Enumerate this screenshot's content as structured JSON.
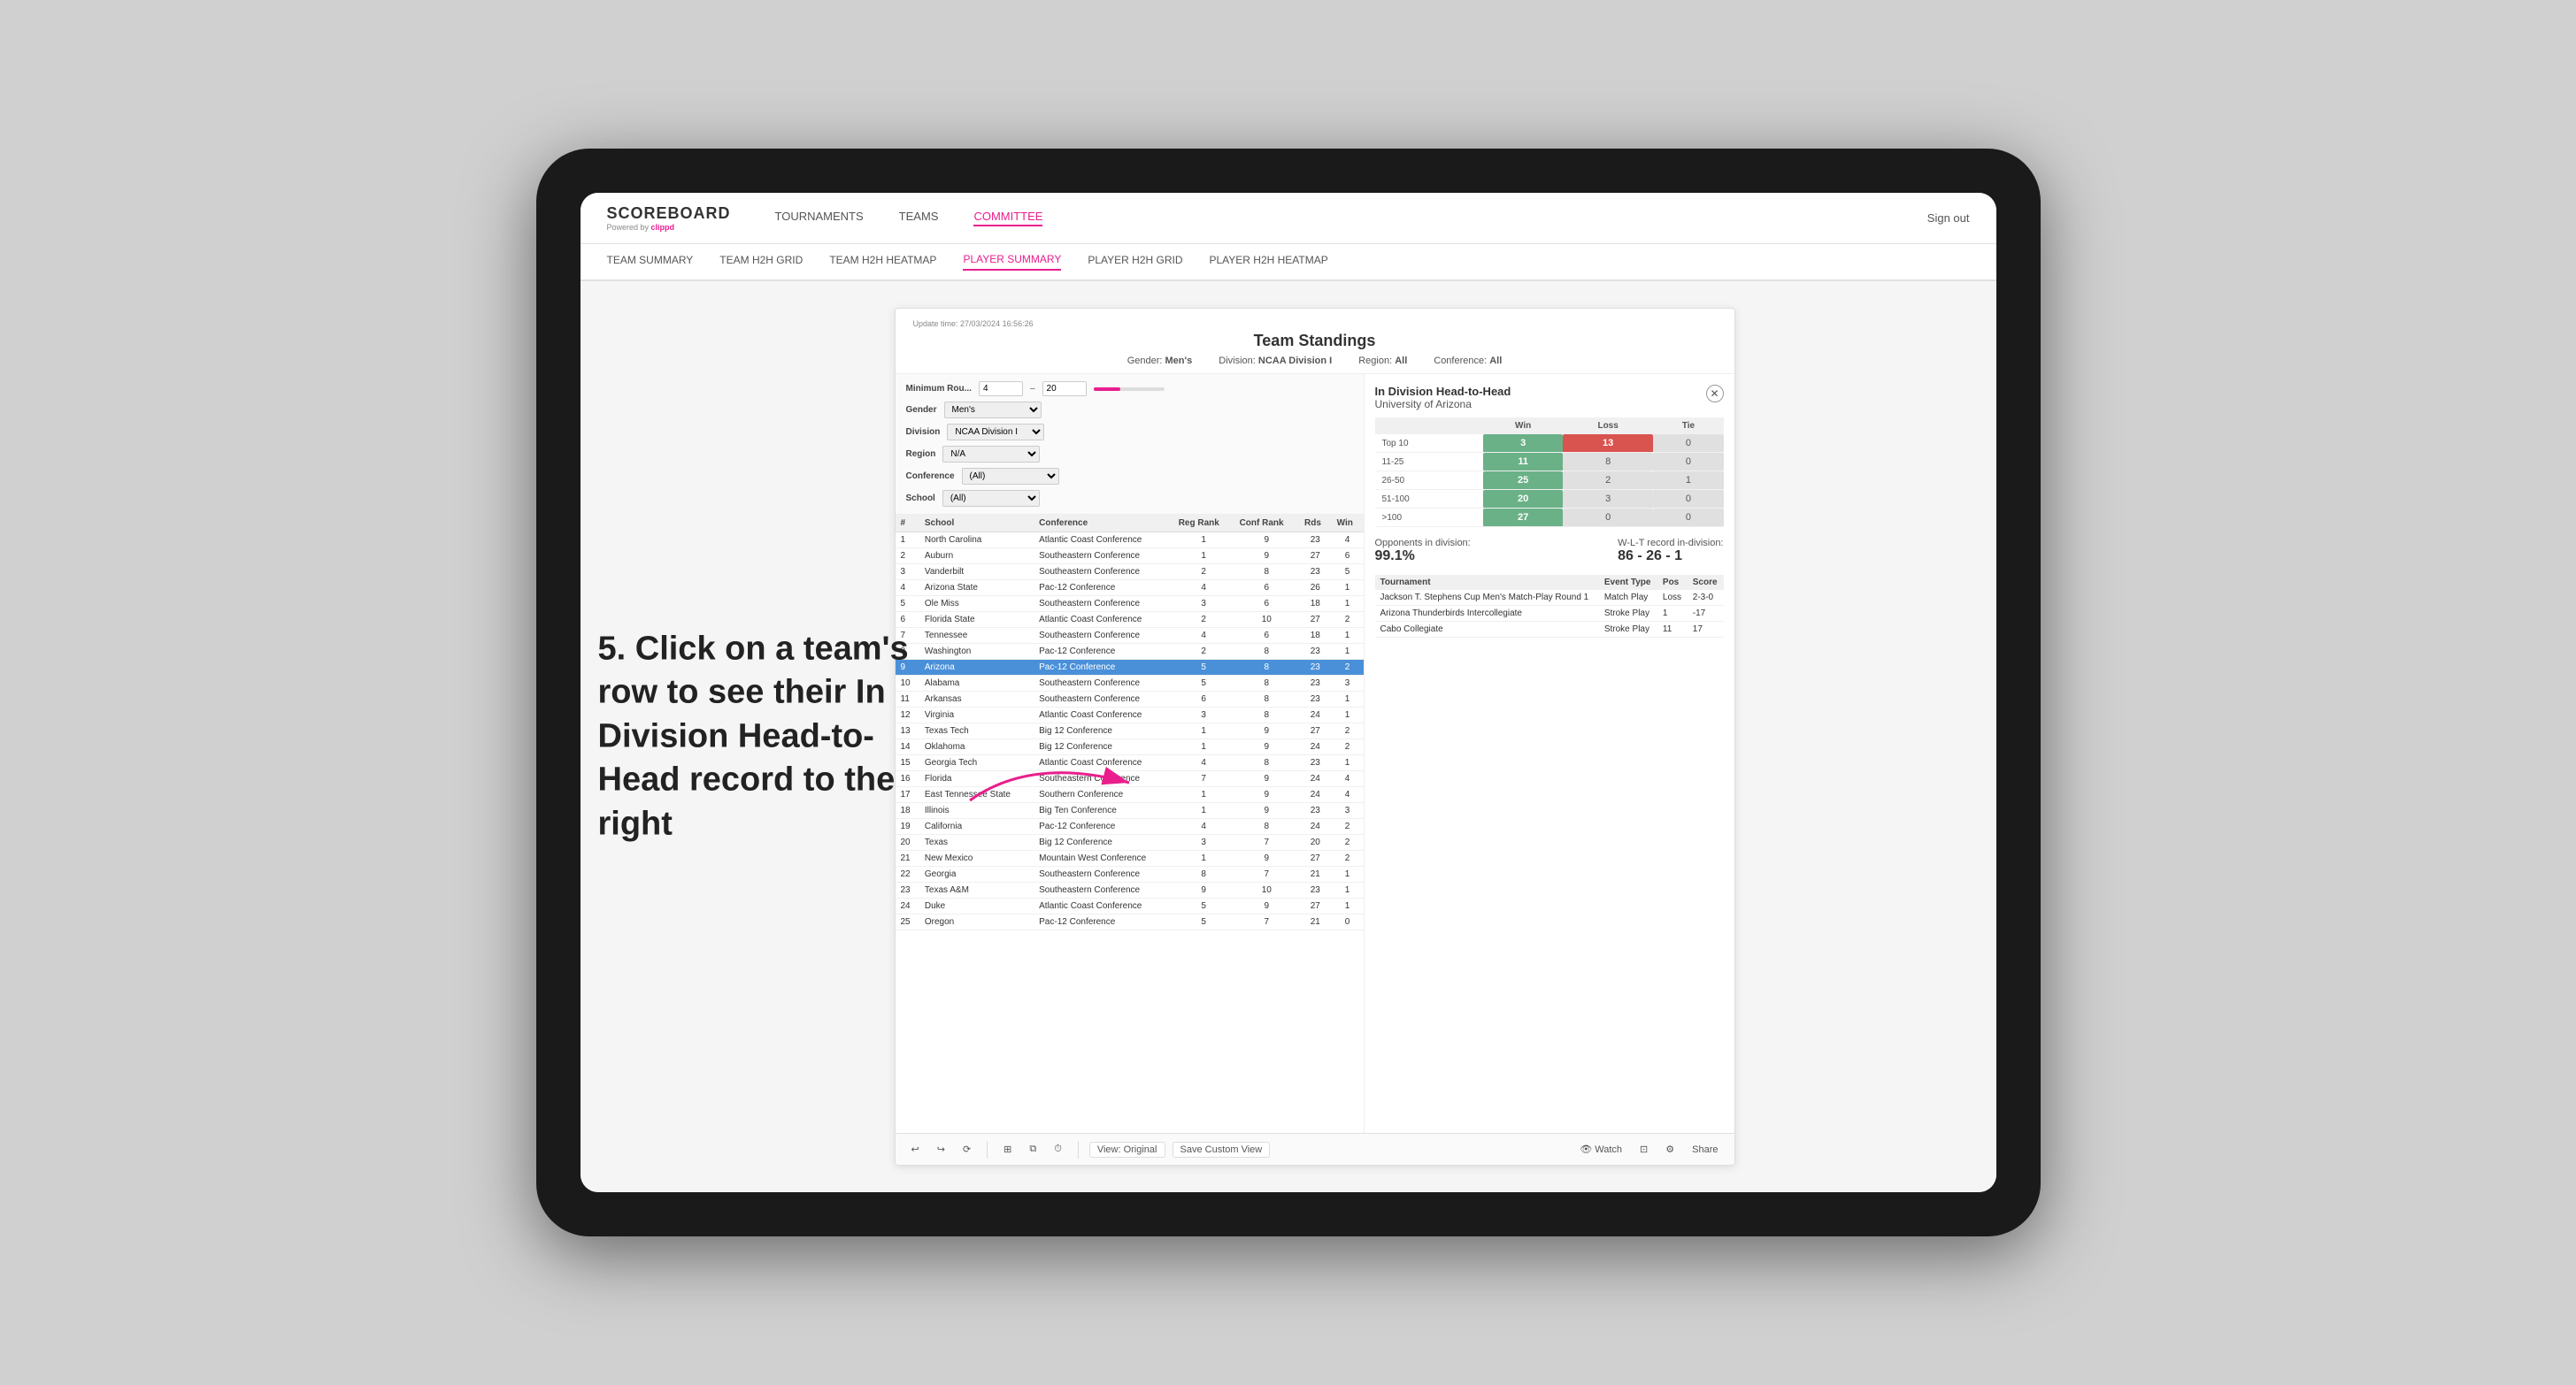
{
  "background": "#d0d0d0",
  "annotation": {
    "text": "5. Click on a team's row to see their In Division Head-to-Head record to the right"
  },
  "nav": {
    "logo": "SCOREBOARD",
    "logo_sub": "Powered by",
    "logo_brand": "clippd",
    "items": [
      "TOURNAMENTS",
      "TEAMS",
      "COMMITTEE"
    ],
    "active_item": "COMMITTEE",
    "sign_out": "Sign out"
  },
  "sub_nav": {
    "items": [
      "TEAM SUMMARY",
      "TEAM H2H GRID",
      "TEAM H2H HEATMAP",
      "PLAYER SUMMARY",
      "PLAYER H2H GRID",
      "PLAYER H2H HEATMAP"
    ],
    "active_item": "PLAYER SUMMARY"
  },
  "panel": {
    "update_time": "Update time: 27/03/2024 16:56:26",
    "title": "Team Standings",
    "filters": {
      "gender": "Men's",
      "division": "NCAA Division I",
      "region": "All",
      "conference": "All"
    },
    "filters_labels": {
      "gender": "Gender:",
      "division": "Division:",
      "region": "Region:",
      "conference": "Conference:"
    },
    "left_filters": {
      "min_rounds_label": "Minimum Rou...",
      "min_rounds_value": "4",
      "max_rounds_value": "20",
      "gender_label": "Gender",
      "gender_value": "Men's",
      "division_label": "Division",
      "division_value": "NCAA Division I",
      "region_label": "Region",
      "region_value": "N/A",
      "conference_label": "Conference",
      "conference_value": "(All)",
      "school_label": "School",
      "school_value": "(All)"
    },
    "table": {
      "columns": [
        "#",
        "School",
        "Conference",
        "Reg Rank",
        "Conf Rank",
        "Rds",
        "Win"
      ],
      "rows": [
        {
          "num": "1",
          "school": "North Carolina",
          "conference": "Atlantic Coast Conference",
          "reg_rank": "1",
          "conf_rank": "9",
          "rds": "23",
          "win": "4"
        },
        {
          "num": "2",
          "school": "Auburn",
          "conference": "Southeastern Conference",
          "reg_rank": "1",
          "conf_rank": "9",
          "rds": "27",
          "win": "6"
        },
        {
          "num": "3",
          "school": "Vanderbilt",
          "conference": "Southeastern Conference",
          "reg_rank": "2",
          "conf_rank": "8",
          "rds": "23",
          "win": "5"
        },
        {
          "num": "4",
          "school": "Arizona State",
          "conference": "Pac-12 Conference",
          "reg_rank": "4",
          "conf_rank": "6",
          "rds": "26",
          "win": "1"
        },
        {
          "num": "5",
          "school": "Ole Miss",
          "conference": "Southeastern Conference",
          "reg_rank": "3",
          "conf_rank": "6",
          "rds": "18",
          "win": "1"
        },
        {
          "num": "6",
          "school": "Florida State",
          "conference": "Atlantic Coast Conference",
          "reg_rank": "2",
          "conf_rank": "10",
          "rds": "27",
          "win": "2"
        },
        {
          "num": "7",
          "school": "Tennessee",
          "conference": "Southeastern Conference",
          "reg_rank": "4",
          "conf_rank": "6",
          "rds": "18",
          "win": "1"
        },
        {
          "num": "8",
          "school": "Washington",
          "conference": "Pac-12 Conference",
          "reg_rank": "2",
          "conf_rank": "8",
          "rds": "23",
          "win": "1"
        },
        {
          "num": "9",
          "school": "Arizona",
          "conference": "Pac-12 Conference",
          "reg_rank": "5",
          "conf_rank": "8",
          "rds": "23",
          "win": "2",
          "highlighted": true
        },
        {
          "num": "10",
          "school": "Alabama",
          "conference": "Southeastern Conference",
          "reg_rank": "5",
          "conf_rank": "8",
          "rds": "23",
          "win": "3"
        },
        {
          "num": "11",
          "school": "Arkansas",
          "conference": "Southeastern Conference",
          "reg_rank": "6",
          "conf_rank": "8",
          "rds": "23",
          "win": "1"
        },
        {
          "num": "12",
          "school": "Virginia",
          "conference": "Atlantic Coast Conference",
          "reg_rank": "3",
          "conf_rank": "8",
          "rds": "24",
          "win": "1"
        },
        {
          "num": "13",
          "school": "Texas Tech",
          "conference": "Big 12 Conference",
          "reg_rank": "1",
          "conf_rank": "9",
          "rds": "27",
          "win": "2"
        },
        {
          "num": "14",
          "school": "Oklahoma",
          "conference": "Big 12 Conference",
          "reg_rank": "1",
          "conf_rank": "9",
          "rds": "24",
          "win": "2"
        },
        {
          "num": "15",
          "school": "Georgia Tech",
          "conference": "Atlantic Coast Conference",
          "reg_rank": "4",
          "conf_rank": "8",
          "rds": "23",
          "win": "1"
        },
        {
          "num": "16",
          "school": "Florida",
          "conference": "Southeastern Conference",
          "reg_rank": "7",
          "conf_rank": "9",
          "rds": "24",
          "win": "4"
        },
        {
          "num": "17",
          "school": "East Tennessee State",
          "conference": "Southern Conference",
          "reg_rank": "1",
          "conf_rank": "9",
          "rds": "24",
          "win": "4"
        },
        {
          "num": "18",
          "school": "Illinois",
          "conference": "Big Ten Conference",
          "reg_rank": "1",
          "conf_rank": "9",
          "rds": "23",
          "win": "3"
        },
        {
          "num": "19",
          "school": "California",
          "conference": "Pac-12 Conference",
          "reg_rank": "4",
          "conf_rank": "8",
          "rds": "24",
          "win": "2"
        },
        {
          "num": "20",
          "school": "Texas",
          "conference": "Big 12 Conference",
          "reg_rank": "3",
          "conf_rank": "7",
          "rds": "20",
          "win": "2"
        },
        {
          "num": "21",
          "school": "New Mexico",
          "conference": "Mountain West Conference",
          "reg_rank": "1",
          "conf_rank": "9",
          "rds": "27",
          "win": "2"
        },
        {
          "num": "22",
          "school": "Georgia",
          "conference": "Southeastern Conference",
          "reg_rank": "8",
          "conf_rank": "7",
          "rds": "21",
          "win": "1"
        },
        {
          "num": "23",
          "school": "Texas A&M",
          "conference": "Southeastern Conference",
          "reg_rank": "9",
          "conf_rank": "10",
          "rds": "23",
          "win": "1"
        },
        {
          "num": "24",
          "school": "Duke",
          "conference": "Atlantic Coast Conference",
          "reg_rank": "5",
          "conf_rank": "9",
          "rds": "27",
          "win": "1"
        },
        {
          "num": "25",
          "school": "Oregon",
          "conference": "Pac-12 Conference",
          "reg_rank": "5",
          "conf_rank": "7",
          "rds": "21",
          "win": "0"
        }
      ]
    },
    "h2h": {
      "title": "In Division Head-to-Head",
      "team": "University of Arizona",
      "table_headers": [
        "",
        "Win",
        "Loss",
        "Tie"
      ],
      "rows": [
        {
          "label": "Top 10",
          "win": "3",
          "loss": "13",
          "tie": "0",
          "win_color": "green",
          "loss_color": "red"
        },
        {
          "label": "11-25",
          "win": "11",
          "loss": "8",
          "tie": "0",
          "win_color": "green",
          "loss_color": "lgray"
        },
        {
          "label": "26-50",
          "win": "25",
          "loss": "2",
          "tie": "1",
          "win_color": "green",
          "loss_color": "lgray"
        },
        {
          "label": "51-100",
          "win": "20",
          "loss": "3",
          "tie": "0",
          "win_color": "green",
          "loss_color": "lgray"
        },
        {
          "label": ">100",
          "win": "27",
          "loss": "0",
          "tie": "0",
          "win_color": "green",
          "loss_color": "lgray"
        }
      ],
      "opponents_label": "Opponents in division:",
      "opponents_value": "99.1%",
      "wlt_label": "W-L-T record in-division:",
      "wlt_value": "86 - 26 - 1",
      "tournament_header": [
        "Tournament",
        "Event Type",
        "Pos",
        "Score"
      ],
      "tournaments": [
        {
          "name": "Jackson T. Stephens Cup Men's Match-Play Round 1",
          "type": "Match Play",
          "pos": "Loss",
          "score": "2-3-0"
        },
        {
          "name": "Arizona Thunderbirds Intercollegiate",
          "type": "Stroke Play",
          "pos": "1",
          "score": "-17"
        },
        {
          "name": "Cabo Collegiate",
          "type": "Stroke Play",
          "pos": "11",
          "score": "17"
        }
      ]
    },
    "toolbar": {
      "undo": "↩",
      "redo_icons": [
        "↩",
        "↪",
        "⟳"
      ],
      "view_original": "View: Original",
      "save_custom": "Save Custom View",
      "watch": "Watch",
      "share": "Share"
    }
  }
}
